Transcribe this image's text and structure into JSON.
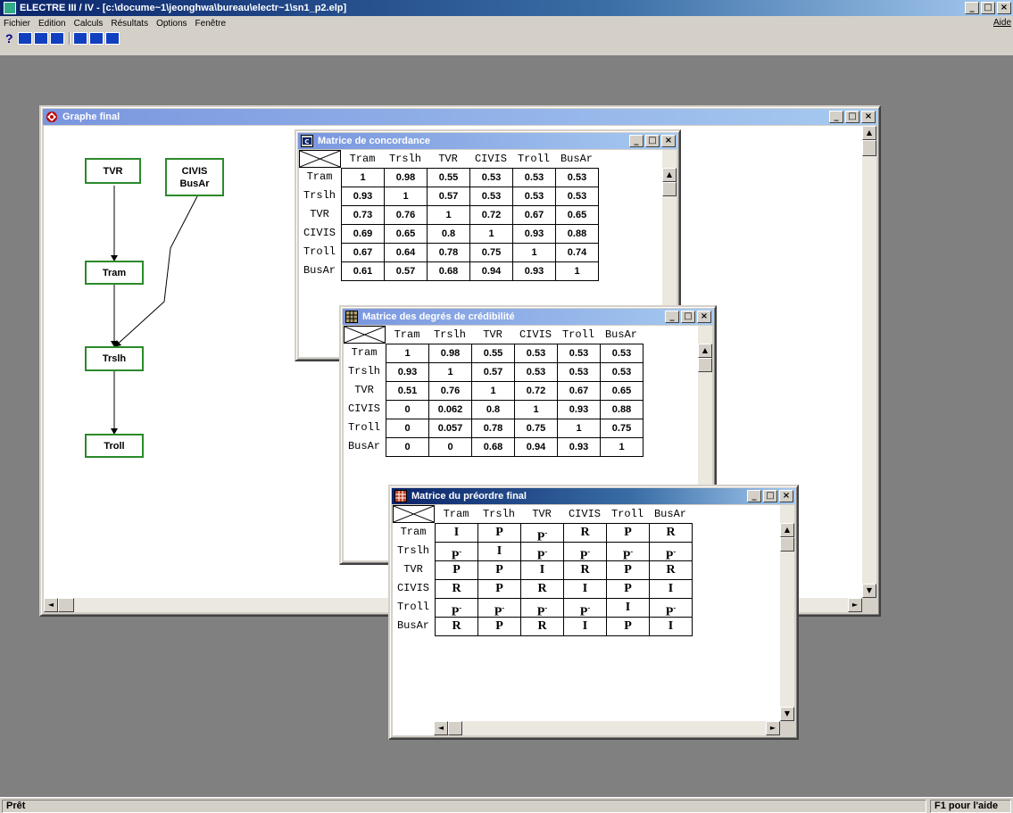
{
  "app": {
    "title": "ELECTRE  III / IV - [c:\\docume~1\\jeonghwa\\bureau\\electr~1\\sn1_p2.elp]",
    "menus": [
      "Fichier",
      "Edition",
      "Calculs",
      "Résultats",
      "Options",
      "Fenêtre"
    ],
    "help_menu": "Aide",
    "toolbar_help": "?",
    "status_left": "Prêt",
    "status_right": "F1 pour l'aide"
  },
  "alternatives": [
    "Tram",
    "Trslh",
    "TVR",
    "CIVIS",
    "Troll",
    "BusAr"
  ],
  "graph": {
    "title": "Graphe final",
    "nodes": [
      {
        "label": "TVR"
      },
      {
        "label": "CIVIS\nBusAr"
      },
      {
        "label": "Tram"
      },
      {
        "label": "Trslh"
      },
      {
        "label": "Troll"
      }
    ]
  },
  "concordance": {
    "title": "Matrice de concordance",
    "cells": [
      [
        "1",
        "0.98",
        "0.55",
        "0.53",
        "0.53",
        "0.53"
      ],
      [
        "0.93",
        "1",
        "0.57",
        "0.53",
        "0.53",
        "0.53"
      ],
      [
        "0.73",
        "0.76",
        "1",
        "0.72",
        "0.67",
        "0.65"
      ],
      [
        "0.69",
        "0.65",
        "0.8",
        "1",
        "0.93",
        "0.88"
      ],
      [
        "0.67",
        "0.64",
        "0.78",
        "0.75",
        "1",
        "0.74"
      ],
      [
        "0.61",
        "0.57",
        "0.68",
        "0.94",
        "0.93",
        "1"
      ]
    ]
  },
  "credibility": {
    "title": "Matrice des degrés de crédibilité",
    "cells": [
      [
        "1",
        "0.98",
        "0.55",
        "0.53",
        "0.53",
        "0.53"
      ],
      [
        "0.93",
        "1",
        "0.57",
        "0.53",
        "0.53",
        "0.53"
      ],
      [
        "0.51",
        "0.76",
        "1",
        "0.72",
        "0.67",
        "0.65"
      ],
      [
        "0",
        "0.062",
        "0.8",
        "1",
        "0.93",
        "0.88"
      ],
      [
        "0",
        "0.057",
        "0.78",
        "0.75",
        "1",
        "0.75"
      ],
      [
        "0",
        "0",
        "0.68",
        "0.94",
        "0.93",
        "1"
      ]
    ]
  },
  "preorder": {
    "title": "Matrice du préordre final",
    "cells": [
      [
        "I",
        "P",
        "P-",
        "R",
        "P",
        "R"
      ],
      [
        "P-",
        "I",
        "P-",
        "P-",
        "P-",
        "P-"
      ],
      [
        "P",
        "P",
        "I",
        "R",
        "P",
        "R"
      ],
      [
        "R",
        "P",
        "R",
        "I",
        "P",
        "I"
      ],
      [
        "P-",
        "P-",
        "P-",
        "P-",
        "I",
        "P-"
      ],
      [
        "R",
        "P",
        "R",
        "I",
        "P",
        "I"
      ]
    ]
  },
  "colors": {
    "titlebar_active": "#0a246a",
    "titlebar_inactive": "#7a96df",
    "node_border": "#2a8a2a",
    "workspace": "#808080"
  }
}
